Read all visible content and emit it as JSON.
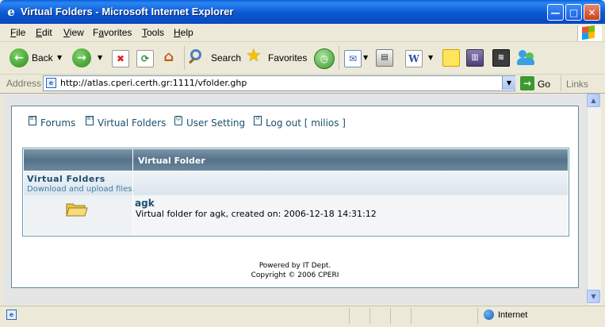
{
  "window": {
    "title": "Virtual Folders - Microsoft Internet Explorer",
    "minimize_glyph": "—",
    "maximize_glyph": "□",
    "close_glyph": "✕"
  },
  "menu": {
    "items": [
      {
        "label": "File",
        "key": "F",
        "rest": "ile"
      },
      {
        "label": "Edit",
        "key": "E",
        "rest": "dit"
      },
      {
        "label": "View",
        "key": "V",
        "rest": "iew"
      },
      {
        "label": "Favorites",
        "key": "a",
        "pre": "F",
        "rest": "vorites"
      },
      {
        "label": "Tools",
        "key": "T",
        "rest": "ools"
      },
      {
        "label": "Help",
        "key": "H",
        "rest": "elp"
      }
    ]
  },
  "toolbar": {
    "back_label": "Back",
    "search_label": "Search",
    "favorites_label": "Favorites"
  },
  "address": {
    "label": "Address",
    "url": "http://atlas.cperi.certh.gr:1111/vfolder.ghp",
    "go_label": "Go",
    "links_label": "Links"
  },
  "page": {
    "nav": [
      {
        "label": "Forums"
      },
      {
        "label": "Virtual Folders"
      },
      {
        "label": "User Setting"
      },
      {
        "label": "Log out [ milios ]"
      }
    ],
    "table_header": "Virtual Folder",
    "category_title": "Virtual Folders",
    "category_subtitle": "Download and upload files.",
    "folder_name": "agk",
    "folder_description": "Virtual folder for agk, created on: 2006-12-18 14:31:12",
    "footer_line1": "Powered by IT Dept.",
    "footer_line2": "Copyright © 2006 CPERI"
  },
  "status": {
    "zone": "Internet"
  },
  "colors": {
    "titlebar": "#0b58d1",
    "link": "#1b4f6e",
    "table_header": "#55728a"
  }
}
